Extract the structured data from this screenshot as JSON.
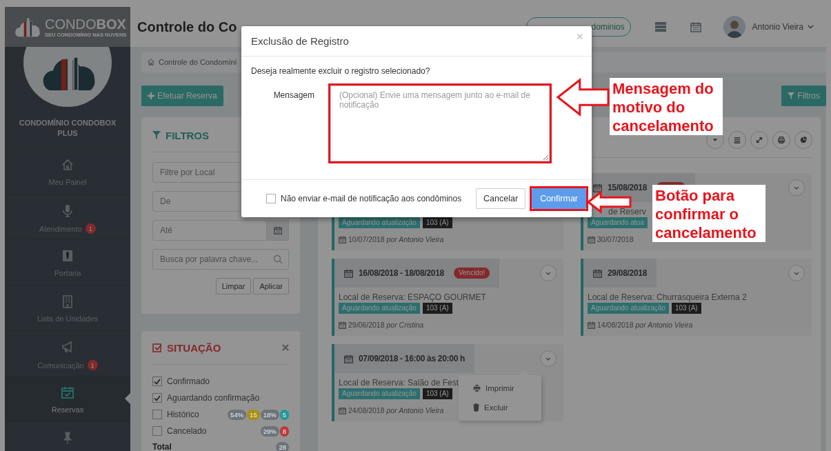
{
  "sidebar": {
    "brand": "CONDO**BOX**",
    "tagline": "SEU CONDOMÍNIO NAS NUVENS",
    "condo_name": "CONDOMÍNIO CONDOBOX PLUS",
    "items": [
      {
        "label": "Meu Painel",
        "selected": false
      },
      {
        "label": "Atendimento",
        "badge": "1",
        "selected": false
      },
      {
        "label": "Portaria",
        "selected": false
      },
      {
        "label": "Lista de Unidades",
        "selected": false
      },
      {
        "label": "Comunicação",
        "badge": "1",
        "selected": false
      },
      {
        "label": "Reservas",
        "selected": true
      },
      {
        "selected": false
      }
    ]
  },
  "header": {
    "title": "Controle do Co",
    "condos_button": "dominios",
    "user": "Antonio Vieira"
  },
  "breadcrumb": "Controle do Condomíni",
  "actions": {
    "primary": "Efetuar Reserva",
    "filters": "Filtros"
  },
  "filters": {
    "title": "FILTROS",
    "fields": [
      {
        "placeholder": "Filtre por Local",
        "kind": "text"
      },
      {
        "placeholder": "De",
        "kind": "text"
      },
      {
        "placeholder": "Até",
        "kind": "date"
      },
      {
        "placeholder": "Busca por palavra chave...",
        "kind": "search"
      }
    ],
    "buttons": [
      "Limpar",
      "Aplicar"
    ]
  },
  "situation": {
    "title": "SITUAÇÃO",
    "items": [
      {
        "label": "Confirmado",
        "checked": true
      },
      {
        "label": "Aguardando confirmação",
        "checked": true
      },
      {
        "label": "Histórico",
        "checked": false,
        "badges": [
          {
            "text": "54%",
            "color": "#6c737a"
          },
          {
            "text": "15",
            "color": "#a88f12"
          },
          {
            "text": "18%",
            "color": "#6c737a"
          },
          {
            "text": "5",
            "color": "#22979a"
          }
        ]
      },
      {
        "label": "Cancelado",
        "checked": false,
        "badges": [
          {
            "text": "29%",
            "color": "#6c737a"
          },
          {
            "text": "8",
            "color": "#b83a3d"
          }
        ]
      }
    ],
    "total_label": "Total",
    "total": "28"
  },
  "cards": [
    {
      "tags": [
        {
          "text": "Aguardando atualização",
          "kind": "status"
        },
        {
          "text": "103 (A)",
          "kind": "unit"
        }
      ],
      "created": "10/07/2018 *por Antonio Vieira*"
    },
    {
      "date": "16/08/2018 - 18/08/2018",
      "expired": true,
      "badge": "Vencido!",
      "local": "Local de Reserva: ESPAÇO GOURMET",
      "tags": [
        {
          "text": "Aguardando atualização",
          "kind": "status"
        },
        {
          "text": "103 (A)",
          "kind": "unit"
        }
      ],
      "created": "29/06/2018 *por Cristina*"
    },
    {
      "date": "07/09/2018 - 16:00 às 20:00 h",
      "expired": false,
      "local": "Local de Reserva: Salão de Fest",
      "tags": [
        {
          "text": "Aguardando atualização",
          "kind": "status"
        },
        {
          "text": "103 (A)",
          "kind": "unit"
        }
      ],
      "created": "24/08/2018 *por Antonio Vieira*",
      "menu": [
        {
          "label": "Imprimir",
          "kind": "print"
        },
        {
          "label": "Excluir",
          "kind": "delete"
        }
      ]
    },
    {
      "date": "15/08/2018",
      "expired": true,
      "local": "de Reserv",
      "tags": [
        {
          "text": "Aguardando atua",
          "kind": "status"
        }
      ],
      "created": "30/07/2018"
    },
    {
      "date": "29/08/2018",
      "expired": false,
      "local": "Local de Reserva: Churrasqueira Externa 2",
      "tags": [
        {
          "text": "Aguardando atualização",
          "kind": "status"
        },
        {
          "text": "103 (A)",
          "kind": "unit"
        }
      ],
      "created": "14/08/2018 *por Antonio Vieira*"
    }
  ],
  "modal": {
    "title": "Exclusão de Registro",
    "close": "×",
    "question": "Deseja realmente excluir o registro selecionado?",
    "label": "Mensagem",
    "placeholder": "(Opcional) Envie uma mensagem junto ao e-mail de notificação",
    "checkbox": {
      "label": "Não enviar e-mail de notificação aos condôminos",
      "checked": false
    },
    "buttons": [
      {
        "label": "Cancelar",
        "kind": "default"
      },
      {
        "label": "Confirmar",
        "kind": "primary"
      }
    ]
  },
  "callouts": [
    {
      "text": "Mensagem do motivo do cancelamento"
    },
    {
      "text": "Botão para confirmar o cancelamento"
    }
  ]
}
